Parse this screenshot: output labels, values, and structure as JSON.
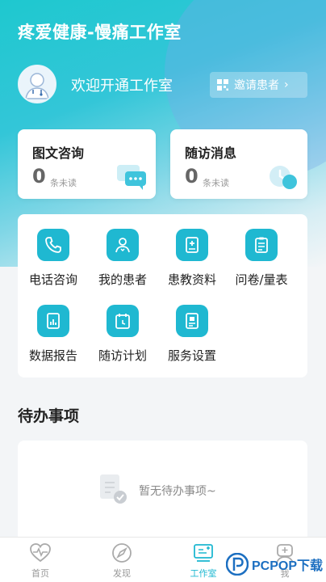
{
  "header": {
    "title": "疼爱健康-慢痛工作室",
    "welcome": "欢迎开通工作室",
    "invite_label": "邀请患者",
    "invite_chevron": "›"
  },
  "cards": [
    {
      "title": "图文咨询",
      "count": "0",
      "unit": "条未读",
      "icon": "chat-bubble-icon"
    },
    {
      "title": "随访消息",
      "count": "0",
      "unit": "条未读",
      "icon": "clock-icon"
    }
  ],
  "functions": [
    {
      "label": "电话咨询",
      "icon": "phone-icon"
    },
    {
      "label": "我的患者",
      "icon": "patients-icon"
    },
    {
      "label": "患教资料",
      "icon": "medical-book-icon"
    },
    {
      "label": "问卷/量表",
      "icon": "questionnaire-icon"
    },
    {
      "label": "数据报告",
      "icon": "report-chart-icon"
    },
    {
      "label": "随访计划",
      "icon": "calendar-icon"
    },
    {
      "label": "服务设置",
      "icon": "service-settings-icon"
    }
  ],
  "todo": {
    "title": "待办事项",
    "empty_text": "暂无待办事项~"
  },
  "tabs": [
    {
      "label": "首页",
      "icon": "heartbeat-icon",
      "active": false
    },
    {
      "label": "发现",
      "icon": "compass-icon",
      "active": false
    },
    {
      "label": "工作室",
      "icon": "workstation-icon",
      "active": true
    },
    {
      "label": "我",
      "icon": "profile-icon",
      "active": false
    }
  ],
  "watermark": {
    "text": "PCPOP下载"
  },
  "colors": {
    "accent": "#1fb8d1",
    "header_start": "#1ec8cf"
  }
}
